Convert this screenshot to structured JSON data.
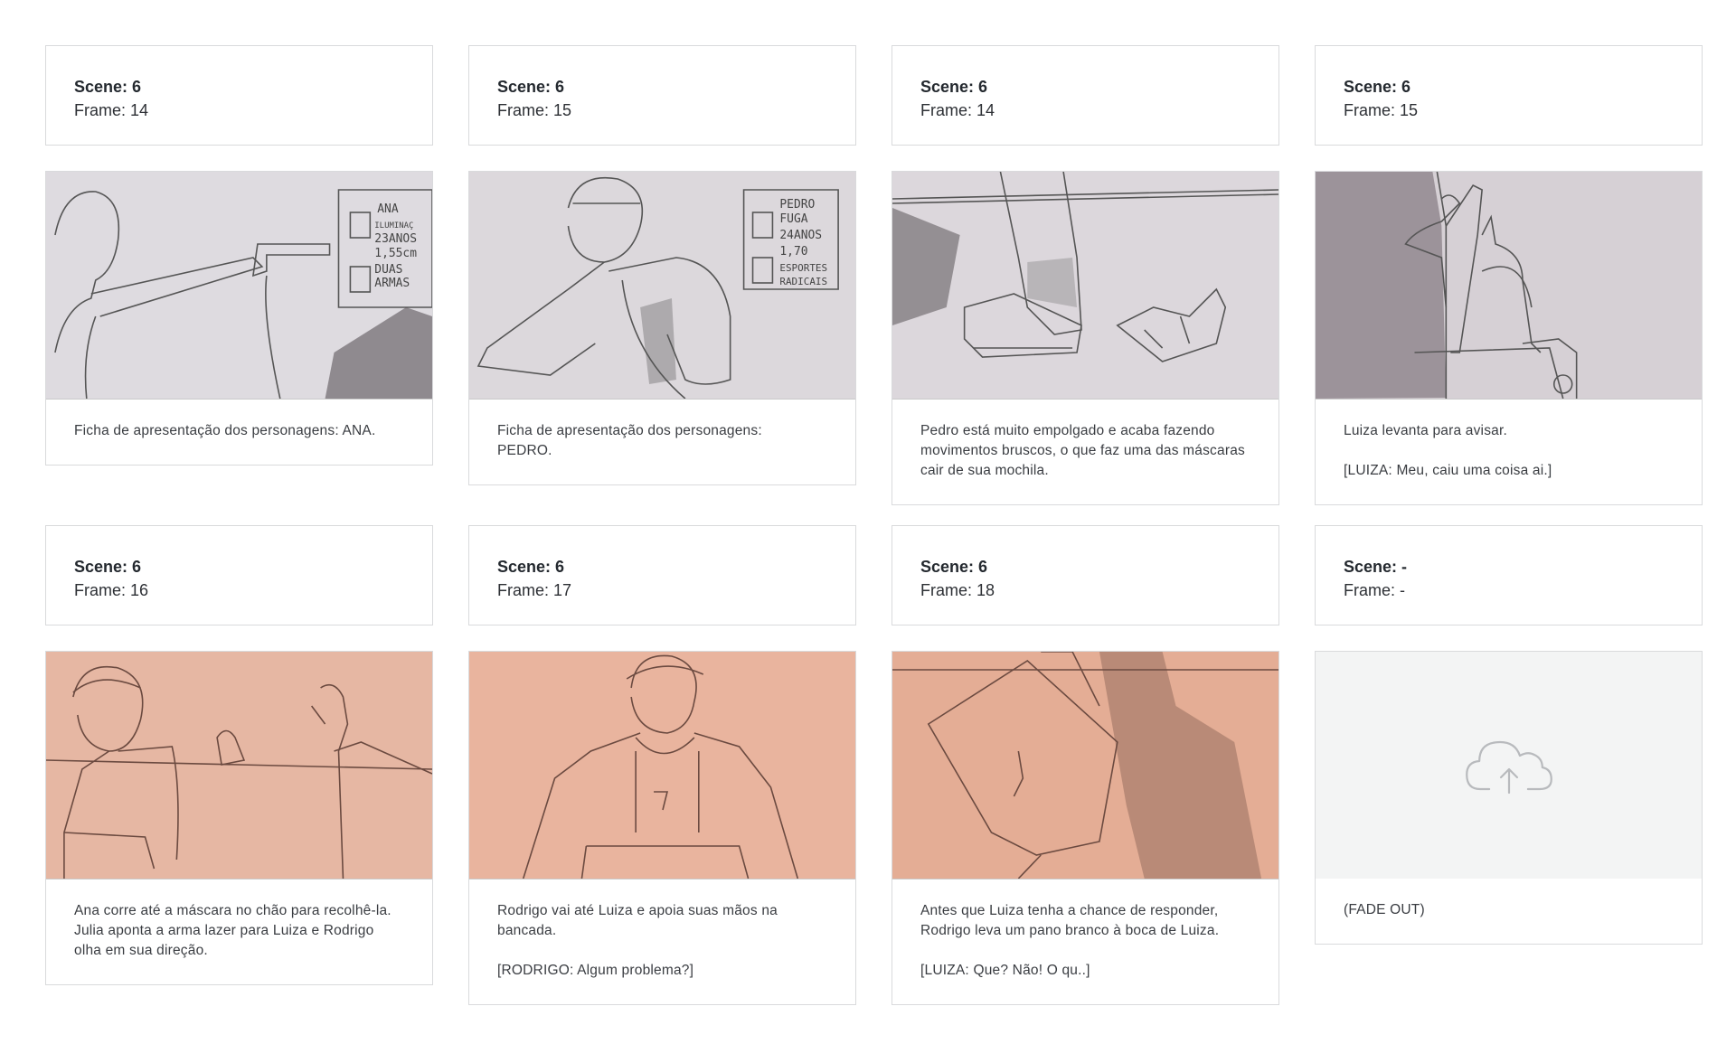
{
  "frames": [
    {
      "scene": "Scene: 6",
      "frame": "Frame: 14",
      "caption": "Ficha de apresentação dos personagens: ANA.",
      "sketch": "pencil-sketch-woman-aiming-gun",
      "tone": "#dedbe0",
      "sketch_text": [
        "ANA",
        "ILUMINAÇ",
        "23ANOS",
        "1,55cm",
        "DUAS",
        "ARMAS"
      ]
    },
    {
      "scene": "Scene: 6",
      "frame": "Frame: 15",
      "caption": "Ficha de apresentação dos personagens:\nPEDRO.",
      "sketch": "pencil-sketch-boy-with-backpack",
      "tone": "#dcd8dc",
      "sketch_text": [
        "PEDRO",
        "FUGA",
        "24ANOS",
        "1,70",
        "ESPORTES",
        "RADICAIS"
      ]
    },
    {
      "scene": "Scene: 6",
      "frame": "Frame: 14",
      "caption": "Pedro está muito empolgado e acaba fazendo movimentos bruscos, o que faz uma das máscaras cair de sua mochila.",
      "sketch": "pencil-sketch-feet-and-mask",
      "tone": "#dcd7dc",
      "sketch_text": []
    },
    {
      "scene": "Scene: 6",
      "frame": "Frame: 15",
      "caption": "Luiza levanta para avisar.\n\n[LUIZA: Meu, caiu uma coisa ai.]",
      "sketch": "pencil-sketch-figure-standing",
      "tone": "#d6d0d5",
      "sketch_text": []
    },
    {
      "scene": "Scene: 6",
      "frame": "Frame: 16",
      "caption": "Ana corre até a máscara no chão para recolhê-la. Julia aponta a arma lazer para Luiza e Rodrigo olha em sua direção.",
      "sketch": "pencil-sketch-three-characters",
      "tone": "#e6b7a3",
      "sketch_text": []
    },
    {
      "scene": "Scene: 6",
      "frame": "Frame: 17",
      "caption": "Rodrigo vai até Luiza e apoia suas mãos na bancada.\n\n[RODRIGO: Algum problema?]",
      "sketch": "pencil-sketch-boy-at-counter",
      "tone": "#e9b49e",
      "sketch_text": []
    },
    {
      "scene": "Scene: 6",
      "frame": "Frame: 18",
      "caption": "Antes que Luiza tenha a chance de responder, Rodrigo leva um pano branco à boca de Luiza.\n\n[LUIZA: Que? Não! O qu..]",
      "sketch": "pencil-sketch-cloth-over-mouth",
      "tone": "#e4ad95",
      "sketch_text": []
    },
    {
      "scene": "Scene: -",
      "frame": "Frame: -",
      "caption": "(FADE OUT)",
      "sketch": "upload-cloud-icon",
      "tone": "#f3f4f4",
      "sketch_text": []
    }
  ]
}
